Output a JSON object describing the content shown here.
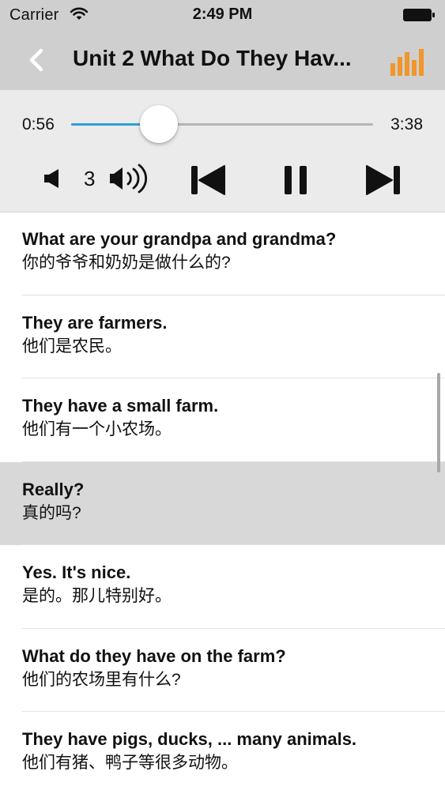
{
  "status_bar": {
    "carrier": "Carrier",
    "time": "2:49 PM",
    "icons": [
      "wifi-icon",
      "battery-icon"
    ]
  },
  "nav": {
    "title": "Unit 2 What Do They Hav...",
    "back_icon": "chevron-left-icon",
    "action_icon": "equalizer-icon",
    "action_color": "#f0962a"
  },
  "player": {
    "elapsed": "0:56",
    "total": "3:38",
    "progress_fraction": 0.2897,
    "volume_level": "3",
    "accent_color": "#2d9fd6",
    "controls": [
      "volume-down-icon",
      "volume-up-icon",
      "previous-track-icon",
      "pause-icon",
      "next-track-icon"
    ]
  },
  "sentences": [
    {
      "en": "What are your grandpa and grandma?",
      "zh": "你的爷爷和奶奶是做什么的?"
    },
    {
      "en": "They are farmers.",
      "zh": "他们是农民。"
    },
    {
      "en": "They have a small farm.",
      "zh": "他们有一个小农场。"
    },
    {
      "en": "Really?",
      "zh": "真的吗?",
      "selected": true
    },
    {
      "en": "Yes. It's nice.",
      "zh": "是的。那儿特别好。"
    },
    {
      "en": "What do they have on the farm?",
      "zh": "他们的农场里有什么?"
    },
    {
      "en": "They have pigs, ducks, ... many animals.",
      "zh": "他们有猪、鸭子等很多动物。"
    }
  ]
}
